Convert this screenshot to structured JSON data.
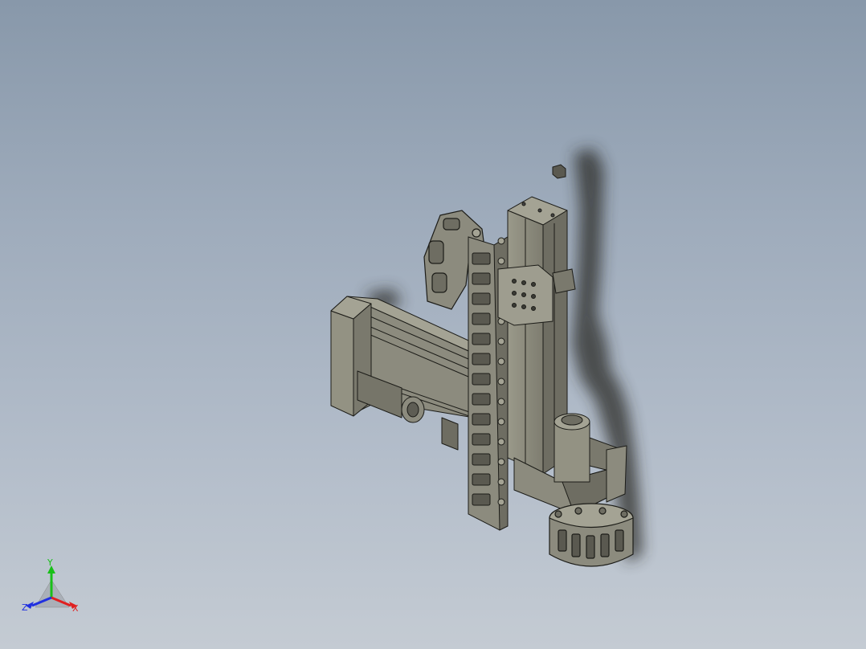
{
  "viewport": {
    "background_top": "#8898aa",
    "background_bottom": "#c4cbd3"
  },
  "model": {
    "body_color": "#8c8b7e",
    "face_light": "#a4a394",
    "face_dark": "#6e6d62",
    "edge_color": "#1c1c18",
    "shadow_color": "#2a2a26"
  },
  "triad": {
    "x": {
      "label": "X",
      "color": "#e02020"
    },
    "y": {
      "label": "Y",
      "color": "#18c018"
    },
    "z": {
      "label": "Z",
      "color": "#2030e0"
    }
  }
}
